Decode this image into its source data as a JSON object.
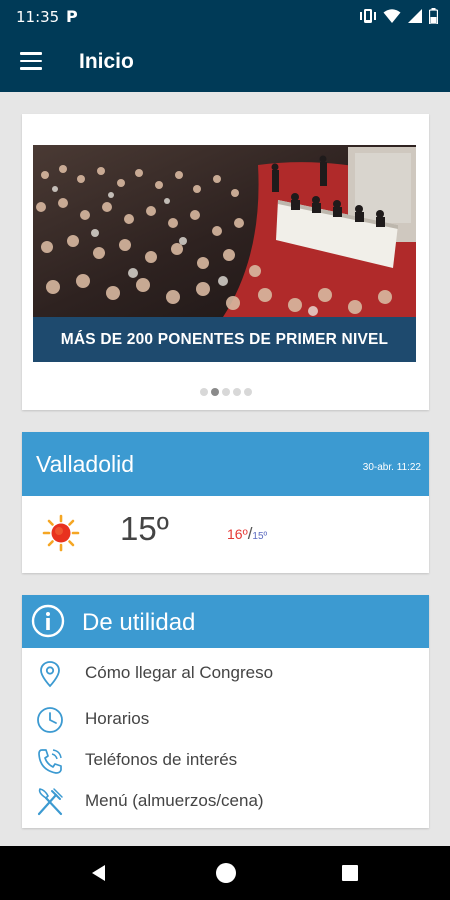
{
  "status_bar": {
    "time": "11:35",
    "app_indicator": "P",
    "icons": [
      "vibrate-icon",
      "wifi-icon",
      "signal-icon",
      "battery-icon"
    ]
  },
  "app_bar": {
    "title": "Inicio",
    "menu_icon": "hamburger-menu-icon"
  },
  "carousel": {
    "caption": "MÁS DE 200 PONENTES DE PRIMER NIVEL",
    "slide_count": 5,
    "active_index": 1
  },
  "weather": {
    "city": "Valladolid",
    "updated": "30-abr. 11:22",
    "current_temp": "15º",
    "high": "16º",
    "separator": "/",
    "low": "15º",
    "icon": "sun-icon",
    "colors": {
      "header": "#3c9ad1",
      "high": "#e53935",
      "low": "#5c6bc0"
    }
  },
  "utility": {
    "title": "De utilidad",
    "icon": "info-icon",
    "items": [
      {
        "label": "Cómo llegar al Congreso",
        "icon": "location-pin-icon"
      },
      {
        "label": "Horarios",
        "icon": "clock-icon"
      },
      {
        "label": "Teléfonos de interés",
        "icon": "phone-icon"
      },
      {
        "label": "Menú (almuerzos/cena)",
        "icon": "fork-knife-icon"
      }
    ]
  },
  "nav_bar": {
    "buttons": [
      "back-icon",
      "home-icon",
      "recents-icon"
    ]
  },
  "colors": {
    "app_bar": "#003a57",
    "accent": "#3c9ad1",
    "background": "#e6e6e6"
  }
}
